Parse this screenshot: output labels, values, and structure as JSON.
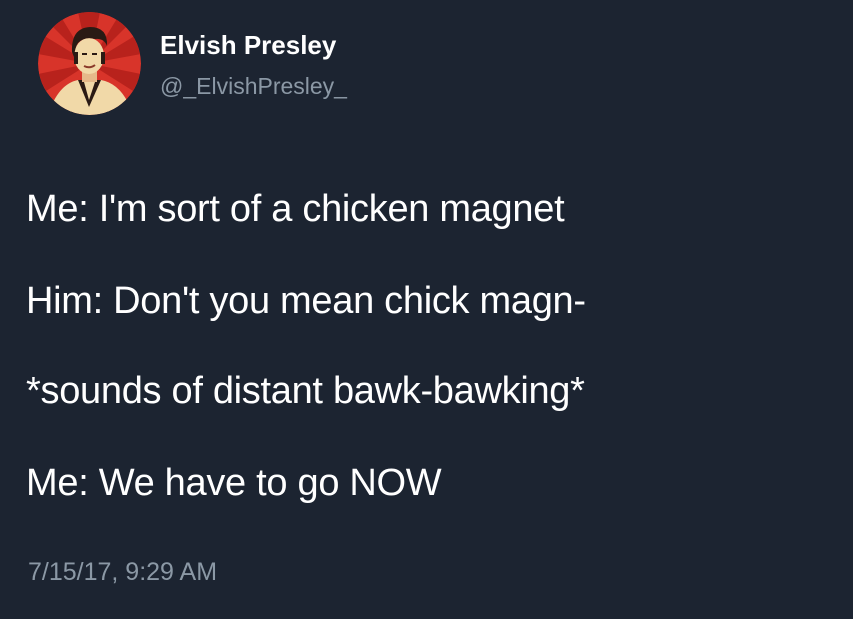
{
  "tweet": {
    "author": {
      "display_name": "Elvish Presley",
      "handle": "@_ElvishPresley_",
      "avatar_icon": "elvis-portrait-avatar"
    },
    "lines": [
      "Me: I'm sort of a chicken magnet",
      "Him: Don't you mean chick magn-",
      "*sounds of distant bawk-bawking*",
      "Me: We have to go NOW"
    ],
    "timestamp": "7/15/17, 9:29 AM"
  },
  "colors": {
    "background": "#1c2431",
    "primary_text": "#ffffff",
    "secondary_text": "#8b98a5",
    "avatar_red": "#d8342a",
    "avatar_cream": "#f1d9a8"
  }
}
